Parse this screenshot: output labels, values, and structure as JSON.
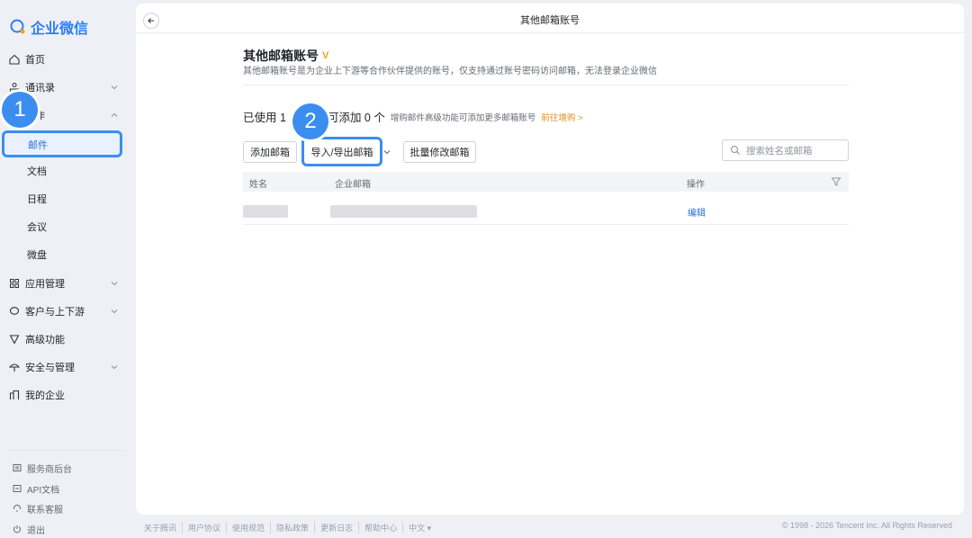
{
  "app": {
    "logo_text": "企业微信",
    "brand_color": "#2c7ef8"
  },
  "sidebar": {
    "items": [
      {
        "label": "首页",
        "icon": "home-icon"
      },
      {
        "label": "通讯录",
        "icon": "contacts-icon"
      },
      {
        "label": "协作",
        "icon": "collab-icon"
      },
      {
        "label": "应用管理",
        "icon": "apps-icon"
      },
      {
        "label": "客户与上下游",
        "icon": "chat-icon"
      },
      {
        "label": "高级功能",
        "icon": "v-icon"
      },
      {
        "label": "安全与管理",
        "icon": "umbrella-icon"
      },
      {
        "label": "我的企业",
        "icon": "building-icon"
      }
    ],
    "sub_items": [
      "邮件",
      "文档",
      "日程",
      "会议",
      "微盘"
    ],
    "bottom_links": [
      {
        "label": "服务商后台",
        "icon": "panel-icon"
      },
      {
        "label": "API文档",
        "icon": "doc-icon"
      },
      {
        "label": "联系客服",
        "icon": "support-icon"
      },
      {
        "label": "退出",
        "icon": "power-icon"
      }
    ]
  },
  "annotations": {
    "step1": "1",
    "step2": "2"
  },
  "header": {
    "title": "其他邮箱账号"
  },
  "section": {
    "title": "其他邮箱账号",
    "badge": "V",
    "description": "其他邮箱账号是为企业上下游等合作伙伴提供的账号，仅支持通过账号密码访问邮箱，无法登录企业微信"
  },
  "usage": {
    "used_prefix": "已使用 1",
    "available": "可添加 0 个",
    "hint": "增购邮件高级功能可添加更多邮箱账号",
    "link": "前往增购 >"
  },
  "toolbar": {
    "add_label": "添加邮箱",
    "import_label": "导入/导出邮箱",
    "batch_label": "批量修改邮箱",
    "search_placeholder": "搜索姓名或邮箱"
  },
  "table": {
    "columns": [
      "姓名",
      "企业邮箱",
      "操作"
    ],
    "row_action": "编辑"
  },
  "footer": {
    "links": [
      "关于腾讯",
      "用户协议",
      "使用规范",
      "隐私政策",
      "更新日志",
      "帮助中心",
      "中文 ▾"
    ],
    "copyright": "© 1998 - 2026 Tencent Inc. All Rights Reserved"
  }
}
